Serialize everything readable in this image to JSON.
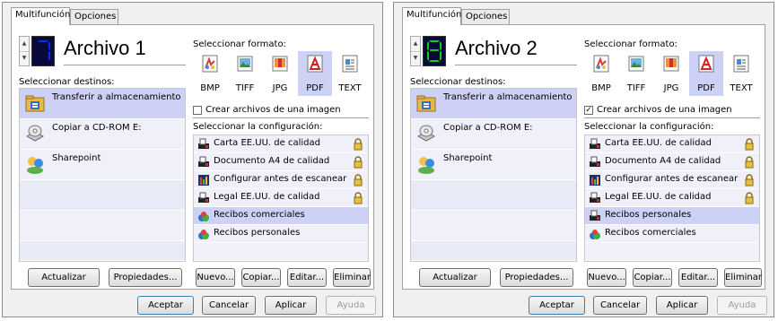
{
  "colors": {
    "selection": "#cdd1f5",
    "list_bg": "#f0f0fb",
    "window_bg": "#f0f0f0",
    "digit_color": "#0030ff",
    "digit_color_2": "#10d010"
  },
  "windows": [
    {
      "tabs": [
        "Multifunción",
        "Opciones"
      ],
      "config_number": "7",
      "config_title": "Archivo 1",
      "dest_label": "Seleccionar destinos:",
      "destinations": [
        {
          "label": "Transferir a almacenamiento",
          "icon": "storage-folder-icon",
          "selected": true
        },
        {
          "label": "Copiar a CD-ROM  E:",
          "icon": "cd-rom-icon",
          "selected": false
        },
        {
          "label": "Sharepoint",
          "icon": "sharepoint-icon",
          "selected": false
        }
      ],
      "format_label": "Seleccionar formato:",
      "formats": [
        {
          "label": "BMP",
          "icon": "bmp-icon",
          "selected": false
        },
        {
          "label": "TIFF",
          "icon": "tiff-icon",
          "selected": false
        },
        {
          "label": "JPG",
          "icon": "jpg-icon",
          "selected": false
        },
        {
          "label": "PDF",
          "icon": "pdf-icon",
          "selected": true
        },
        {
          "label": "TEXT",
          "icon": "text-icon",
          "selected": false
        }
      ],
      "single_image_label": "Crear archivos de una imagen",
      "single_image_checked": false,
      "settings_label": "Seleccionar la configuración:",
      "settings": [
        {
          "label": "Carta EE.UU. de calidad",
          "icon": "scanner-icon",
          "locked": true,
          "selected": false
        },
        {
          "label": "Documento A4 de calidad",
          "icon": "scanner-icon",
          "locked": true,
          "selected": false
        },
        {
          "label": "Configurar antes de escanear",
          "icon": "configure-icon",
          "locked": true,
          "selected": false
        },
        {
          "label": "Legal EE.UU. de calidad",
          "icon": "scanner-icon",
          "locked": true,
          "selected": false
        },
        {
          "label": "Recibos comerciales",
          "icon": "receipts-icon",
          "locked": false,
          "selected": true
        },
        {
          "label": "Recibos personales",
          "icon": "receipts-icon",
          "locked": false,
          "selected": false
        }
      ],
      "buttons": {
        "refresh": "Actualizar",
        "properties": "Propiedades...",
        "new": "Nuevo...",
        "copy": "Copiar...",
        "edit": "Editar...",
        "delete": "Eliminar"
      },
      "footer": {
        "ok": "Aceptar",
        "cancel": "Cancelar",
        "apply": "Aplicar",
        "help": "Ayuda"
      }
    },
    {
      "tabs": [
        "Multifunción",
        "Opciones"
      ],
      "config_number": "8",
      "config_title": "Archivo 2",
      "dest_label": "Seleccionar destinos:",
      "destinations": [
        {
          "label": "Transferir a almacenamiento",
          "icon": "storage-folder-icon",
          "selected": true
        },
        {
          "label": "Copiar a CD-ROM  E:",
          "icon": "cd-rom-icon",
          "selected": false
        },
        {
          "label": "Sharepoint",
          "icon": "sharepoint-icon",
          "selected": false
        }
      ],
      "format_label": "Seleccionar formato:",
      "formats": [
        {
          "label": "BMP",
          "icon": "bmp-icon",
          "selected": false
        },
        {
          "label": "TIFF",
          "icon": "tiff-icon",
          "selected": false
        },
        {
          "label": "JPG",
          "icon": "jpg-icon",
          "selected": false
        },
        {
          "label": "PDF",
          "icon": "pdf-icon",
          "selected": true
        },
        {
          "label": "TEXT",
          "icon": "text-icon",
          "selected": false
        }
      ],
      "single_image_label": "Crear archivos de una imagen",
      "single_image_checked": true,
      "settings_label": "Seleccionar la configuración:",
      "settings": [
        {
          "label": "Carta EE.UU. de calidad",
          "icon": "scanner-icon",
          "locked": true,
          "selected": false
        },
        {
          "label": "Documento A4 de calidad",
          "icon": "scanner-icon",
          "locked": true,
          "selected": false
        },
        {
          "label": "Configurar antes de escanear",
          "icon": "configure-icon",
          "locked": true,
          "selected": false
        },
        {
          "label": "Legal EE.UU. de calidad",
          "icon": "scanner-icon",
          "locked": true,
          "selected": false
        },
        {
          "label": "Recibos personales",
          "icon": "scanner-icon",
          "locked": false,
          "selected": true
        },
        {
          "label": "Recibos comerciales",
          "icon": "receipts-icon",
          "locked": false,
          "selected": false
        }
      ],
      "buttons": {
        "refresh": "Actualizar",
        "properties": "Propiedades...",
        "new": "Nuevo...",
        "copy": "Copiar...",
        "edit": "Editar...",
        "delete": "Eliminar"
      },
      "footer": {
        "ok": "Aceptar",
        "cancel": "Cancelar",
        "apply": "Aplicar",
        "help": "Ayuda"
      }
    }
  ]
}
